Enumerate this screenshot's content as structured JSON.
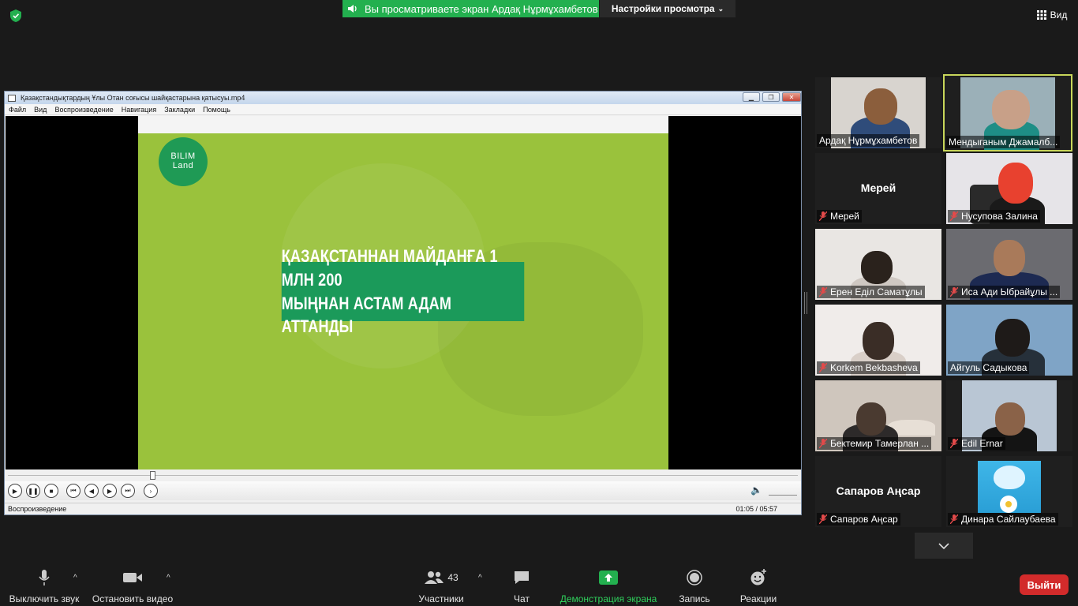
{
  "top": {
    "share_text": "Вы просматриваете экран Ардақ Нұрмұхамбетов",
    "view_settings": "Настройки просмотра",
    "view_label": "Вид"
  },
  "player": {
    "title": "Қазақстандықтардың Ұлы Отан соғысы шайқастарына қатысуы.mp4",
    "menu": [
      "Файл",
      "Вид",
      "Воспроизведение",
      "Навигация",
      "Закладки",
      "Помощь"
    ],
    "logo_line1": "BILIM",
    "logo_line2": "Land",
    "caption_line1": "ҚАЗАҚСТАННАН МАЙДАНҒА 1 МЛН 200",
    "caption_line2": "МЫҢНАН АСТАМ АДАМ АТТАНДЫ",
    "status": "Воспроизведение",
    "time": "01:05 / 05:57",
    "progress": 0.18
  },
  "participants": [
    {
      "name": "Ардақ Нұрмұхамбетов",
      "muted": false,
      "video": true,
      "active": false
    },
    {
      "name": "Мендыганым Джамалб...",
      "muted": false,
      "video": true,
      "active": true
    },
    {
      "name": "Мерей",
      "muted": true,
      "video": false,
      "display": "Мерей"
    },
    {
      "name": "Нусупова Залина",
      "muted": true,
      "video": true
    },
    {
      "name": "Ерен Еділ Саматұлы",
      "muted": true,
      "video": true
    },
    {
      "name": "Иса Ади Ыбрайұлы ...",
      "muted": true,
      "video": true
    },
    {
      "name": "Korkem Bekbasheva",
      "muted": true,
      "video": true
    },
    {
      "name": "Айгуль Садыкова",
      "muted": false,
      "video": true
    },
    {
      "name": "Бектемир Тамерлан ...",
      "muted": true,
      "video": true
    },
    {
      "name": "Edil Ernar",
      "muted": true,
      "video": true
    },
    {
      "name": "Сапаров Аңсар",
      "muted": true,
      "video": false,
      "display": "Сапаров Аңсар"
    },
    {
      "name": "Динара Сайлаубаева",
      "muted": true,
      "video": true
    }
  ],
  "toolbar": {
    "mute": "Выключить звук",
    "stop_video": "Остановить видео",
    "participants": "Участники",
    "participants_count": "43",
    "chat": "Чат",
    "share": "Демонстрация экрана",
    "record": "Запись",
    "reactions": "Реакции",
    "leave": "Выйти"
  },
  "colors": {
    "share_green": "#23b04f",
    "leave_red": "#d22b2b",
    "video_green": "#9ac23c",
    "caption_green": "#1b9a5a"
  }
}
